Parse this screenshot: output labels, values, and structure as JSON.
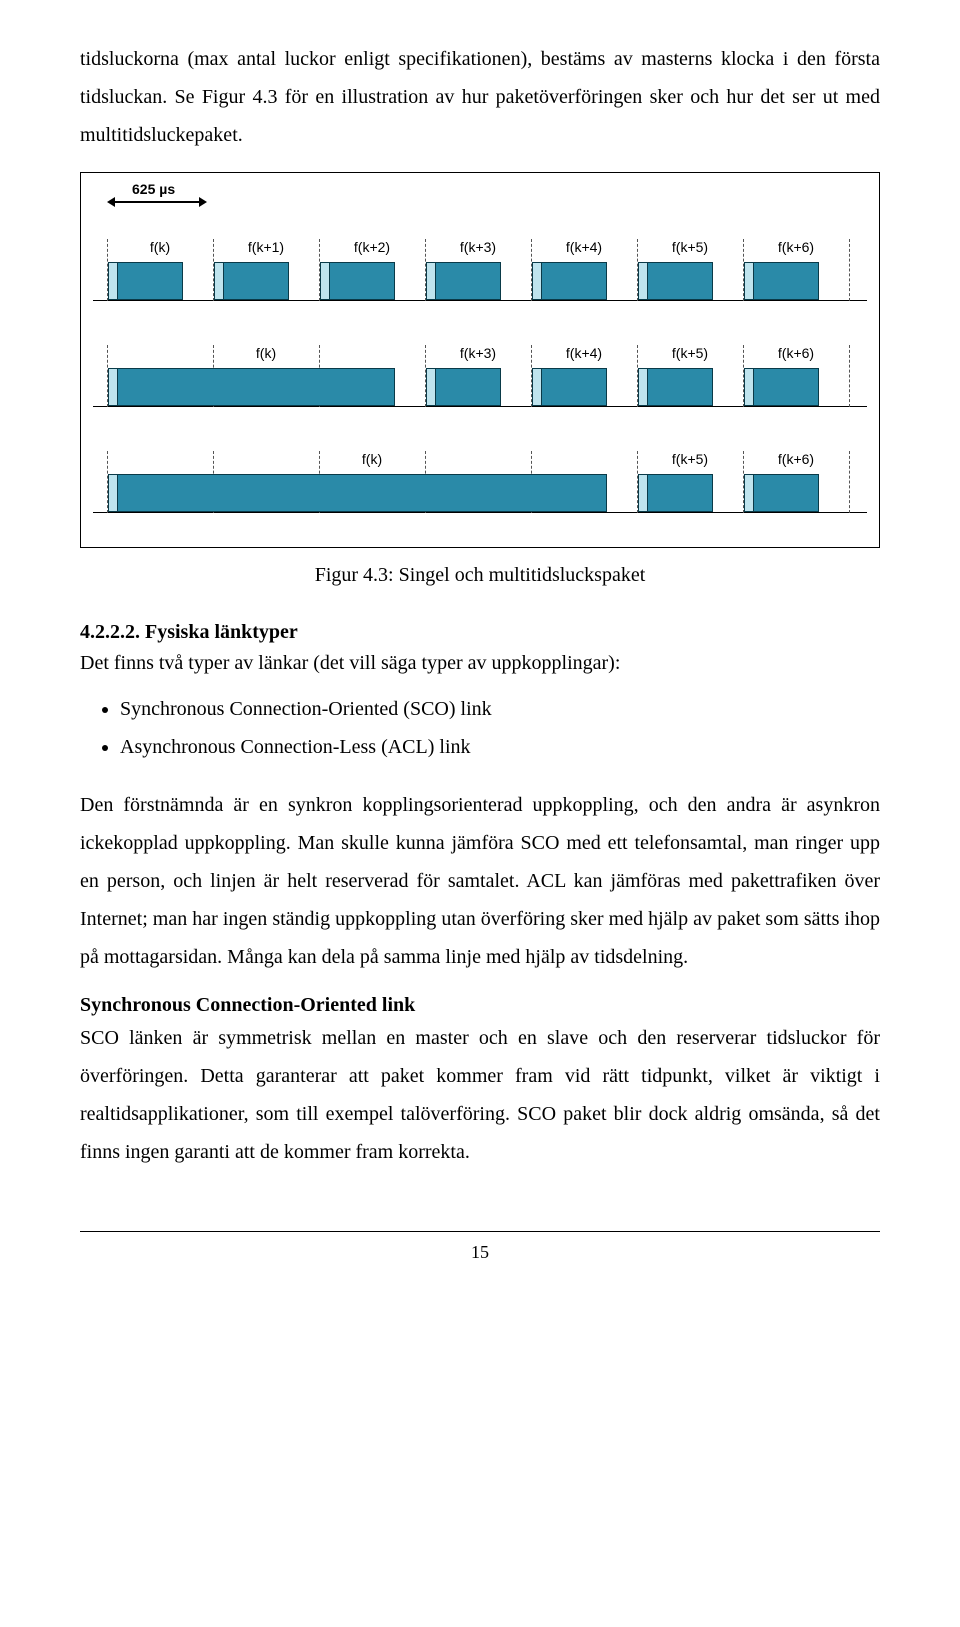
{
  "intro_text": "tidsluckorna (max antal luckor enligt specifikationen), bestäms av masterns klocka i den första tidsluckan. Se Figur 4.3 för en illustration av hur paketöverföringen sker och hur det ser ut med multitidsluckepaket.",
  "figure": {
    "arrow_label": "625 µs",
    "caption": "Figur 4.3: Singel och multitidsluckspaket"
  },
  "section_4222": {
    "heading": "4.2.2.2.  Fysiska länktyper",
    "intro": "Det finns två typer av länkar (det vill säga typer av uppkopplingar):",
    "bullets": [
      "Synchronous Connection-Oriented (SCO) link",
      "Asynchronous Connection-Less (ACL) link"
    ],
    "para1": "Den förstnämnda är en synkron kopplingsorienterad uppkoppling, och den andra är asynkron ickekopplad uppkoppling. Man skulle kunna jämföra SCO med ett telefonsamtal, man ringer upp en person, och linjen är helt reserverad för samtalet. ACL kan jämföras med pakettrafiken över Internet; man har ingen ständig uppkoppling utan överföring sker med hjälp av paket som sätts ihop på mottagarsidan. Många kan dela på samma linje med hjälp av tidsdelning."
  },
  "sco": {
    "heading": "Synchronous Connection-Oriented link",
    "para": "SCO länken är symmetrisk mellan en master och en slave och den reserverar tidsluckor för överföringen. Detta garanterar att paket kommer fram vid rätt tidpunkt, vilket är viktigt i realtidsapplikationer, som till exempel talöverföring. SCO paket blir dock aldrig omsända, så det finns ingen garanti att de kommer fram korrekta."
  },
  "chart_data": {
    "type": "timing-diagram",
    "slot_width_us": 625,
    "num_slots": 7,
    "rows": [
      {
        "labels": [
          "f(k)",
          "f(k+1)",
          "f(k+2)",
          "f(k+3)",
          "f(k+4)",
          "f(k+5)",
          "f(k+6)"
        ],
        "packets": [
          [
            0,
            1
          ],
          [
            1,
            1
          ],
          [
            2,
            1
          ],
          [
            3,
            1
          ],
          [
            4,
            1
          ],
          [
            5,
            1
          ],
          [
            6,
            1
          ]
        ]
      },
      {
        "labels": [
          "f(k)",
          "",
          "",
          "f(k+3)",
          "f(k+4)",
          "f(k+5)",
          "f(k+6)"
        ],
        "packets": [
          [
            0,
            3
          ],
          [
            3,
            1
          ],
          [
            4,
            1
          ],
          [
            5,
            1
          ],
          [
            6,
            1
          ]
        ]
      },
      {
        "labels": [
          "",
          "",
          "f(k)",
          "",
          "",
          "f(k+5)",
          "f(k+6)"
        ],
        "packets": [
          [
            0,
            5
          ],
          [
            5,
            1
          ],
          [
            6,
            1
          ]
        ]
      }
    ]
  },
  "page_number": "15"
}
